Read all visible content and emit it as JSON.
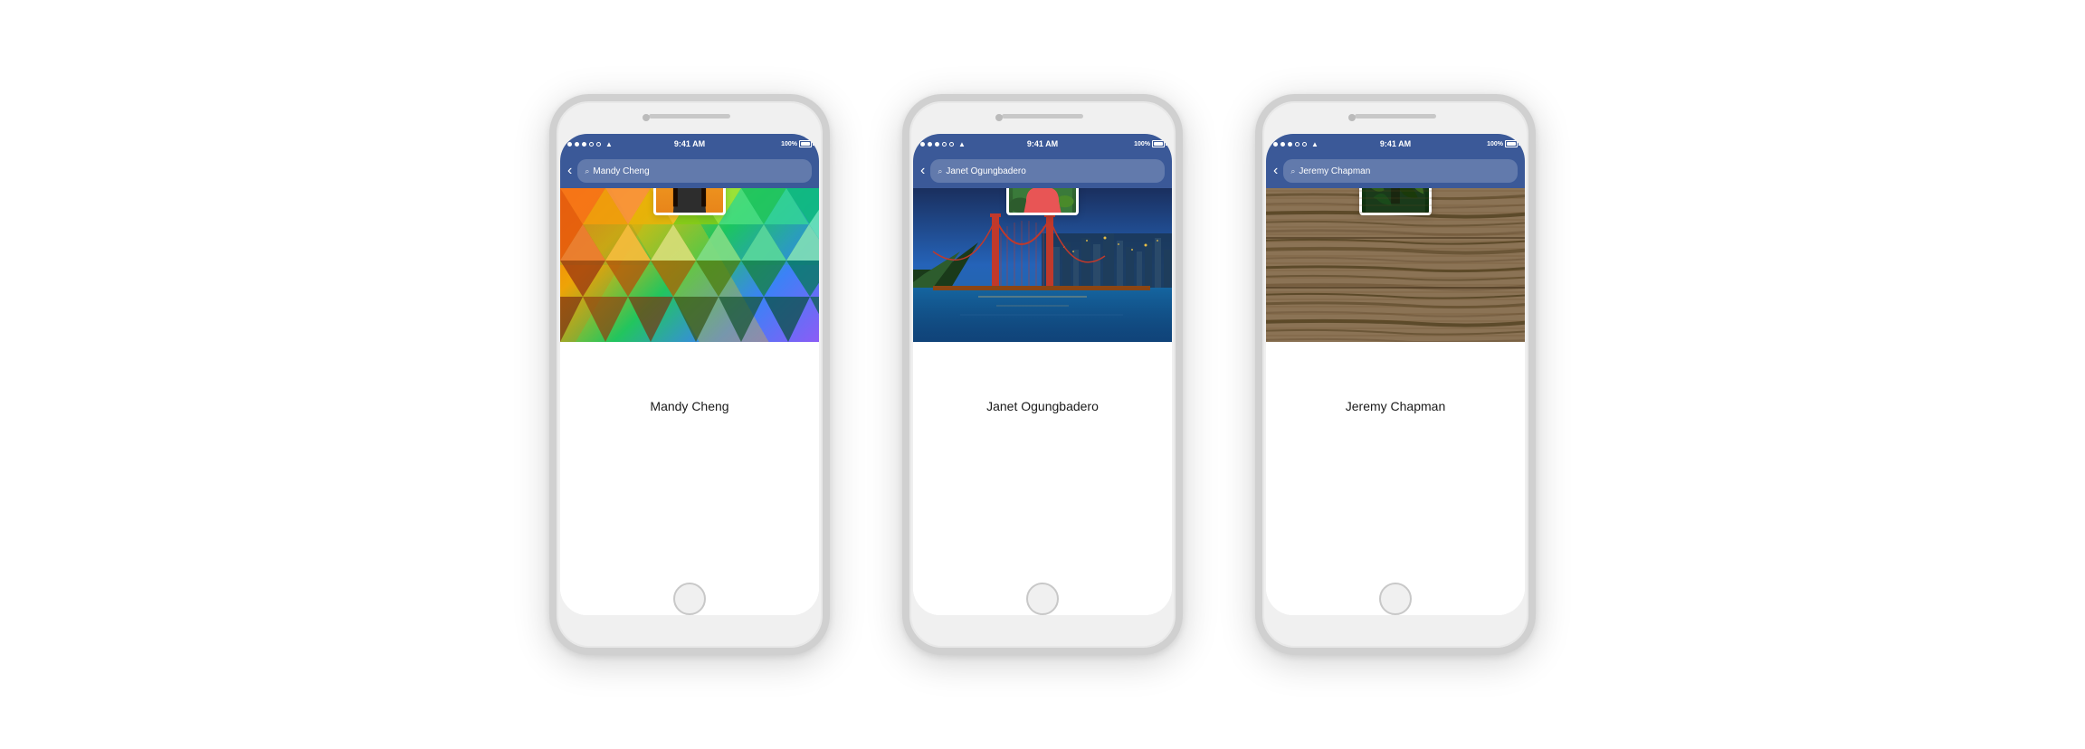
{
  "phones": [
    {
      "id": "phone-mandy",
      "statusBar": {
        "time": "9:41 AM",
        "battery": "100%"
      },
      "searchText": "Mandy Cheng",
      "profileName": "Mandy Cheng",
      "coverType": "mandy",
      "picType": "mandy"
    },
    {
      "id": "phone-janet",
      "statusBar": {
        "time": "9:41 AM",
        "battery": "100%"
      },
      "searchText": "Janet Ogungbadero",
      "profileName": "Janet Ogungbadero",
      "coverType": "janet",
      "picType": "janet"
    },
    {
      "id": "phone-jeremy",
      "statusBar": {
        "time": "9:41 AM",
        "battery": "100%"
      },
      "searchText": "Jeremy Chapman",
      "profileName": "Jeremy Chapman",
      "coverType": "jeremy",
      "picType": "jeremy"
    }
  ],
  "icons": {
    "back": "‹",
    "search": "🔍",
    "wifi": "📶"
  }
}
